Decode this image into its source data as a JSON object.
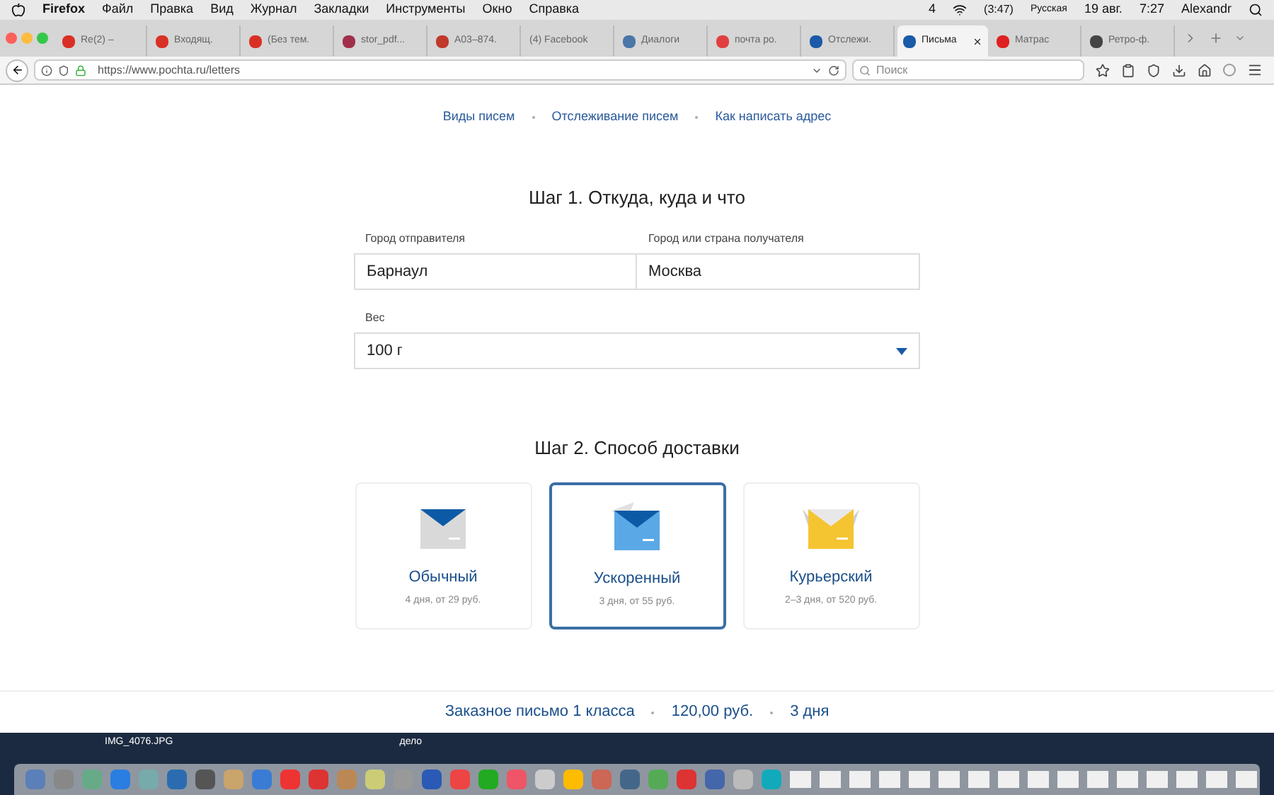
{
  "menu_bar": {
    "app": "Firefox",
    "items": [
      "Файл",
      "Правка",
      "Вид",
      "Журнал",
      "Закладки",
      "Инструменты",
      "Окно",
      "Справка"
    ],
    "status": {
      "badge": "4",
      "battery": "(3:47)",
      "input_source": "Русская",
      "date": "19 авг.",
      "time": "7:27",
      "user": "Alexandr"
    }
  },
  "tabs": [
    {
      "label": "Re(2) –",
      "selected": false,
      "kind": "mail"
    },
    {
      "label": "Входящ.",
      "selected": false,
      "kind": "mail"
    },
    {
      "label": "(Без тем.",
      "selected": false,
      "kind": "mail"
    },
    {
      "label": "stor_pdf...",
      "selected": false,
      "kind": "globe"
    },
    {
      "label": "А03–874.",
      "selected": false,
      "kind": "emblem"
    },
    {
      "label": "(4) Facebook",
      "selected": false,
      "kind": "none"
    },
    {
      "label": "Диалоги",
      "selected": false,
      "kind": "chat"
    },
    {
      "label": "почта ро.",
      "selected": false,
      "kind": "yandex"
    },
    {
      "label": "Отслежи.",
      "selected": false,
      "kind": "post"
    },
    {
      "label": "Письма",
      "selected": true,
      "kind": "post"
    },
    {
      "label": "Матрас",
      "selected": false,
      "kind": "video"
    },
    {
      "label": "Ретро-ф.",
      "selected": false,
      "kind": "book"
    }
  ],
  "url_bar": {
    "url": "https://www.pochta.ru/letters",
    "search_placeholder": "Поиск"
  },
  "page": {
    "links": [
      "Виды писем",
      "Отслеживание писем",
      "Как написать адрес"
    ],
    "step1": {
      "title": "Шаг 1. Откуда, куда и что",
      "from_label": "Город отправителя",
      "from_value": "Барнаул",
      "to_label": "Город или страна получателя",
      "to_value": "Москва",
      "weight_label": "Вес",
      "weight_value": "100 г"
    },
    "step2": {
      "title": "Шаг 2. Способ доставки",
      "options": [
        {
          "kind": "plain",
          "title": "Обычный",
          "subtitle": "4 дня, от 29 руб.",
          "selected": false
        },
        {
          "kind": "fast",
          "title": "Ускоренный",
          "subtitle": "3 дня, от 55 руб.",
          "selected": true
        },
        {
          "kind": "courier",
          "title": "Курьерский",
          "subtitle": "2–3 дня, от 520 руб.",
          "selected": false
        }
      ]
    },
    "summary": [
      "Заказное письмо 1 класса",
      "120,00 руб.",
      "3 дня"
    ]
  },
  "desktop": {
    "files": [
      "IMG_4076.JPG",
      "дело"
    ]
  }
}
